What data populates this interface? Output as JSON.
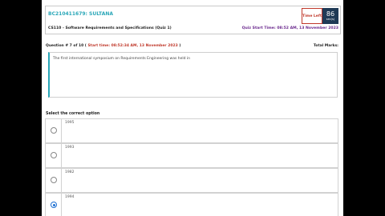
{
  "header": {
    "student": "BC210411679: SULTANA",
    "course": "CS110 - Software Requirements and Specifications (Quiz 1)",
    "quiz_start": "Quiz Start Time: 08:52 AM, 13 November 2023",
    "timer_label": "Time Left",
    "timer_value": "86",
    "timer_unit": "sec(s)"
  },
  "question": {
    "number_label": "Question # 7 of 10 (",
    "start_time": "Start time: 08:52:34 AM, 13 November 2023",
    "close_paren": ")",
    "total_marks": "Total Marks: ",
    "text": "The first international symposium on Requirements Engineering was held in"
  },
  "options": {
    "select_label": "Select the correct option",
    "items": [
      {
        "text": "1995",
        "selected": false
      },
      {
        "text": "1993",
        "selected": false
      },
      {
        "text": "1982",
        "selected": false
      },
      {
        "text": "1994",
        "selected": true
      }
    ]
  },
  "colors": {
    "accent": "#2aa7b8",
    "timer_bg": "#1f3a56",
    "alert": "#c0392b",
    "quiz_start": "#6b2a8e",
    "radio_selected": "#1d6fd1"
  }
}
